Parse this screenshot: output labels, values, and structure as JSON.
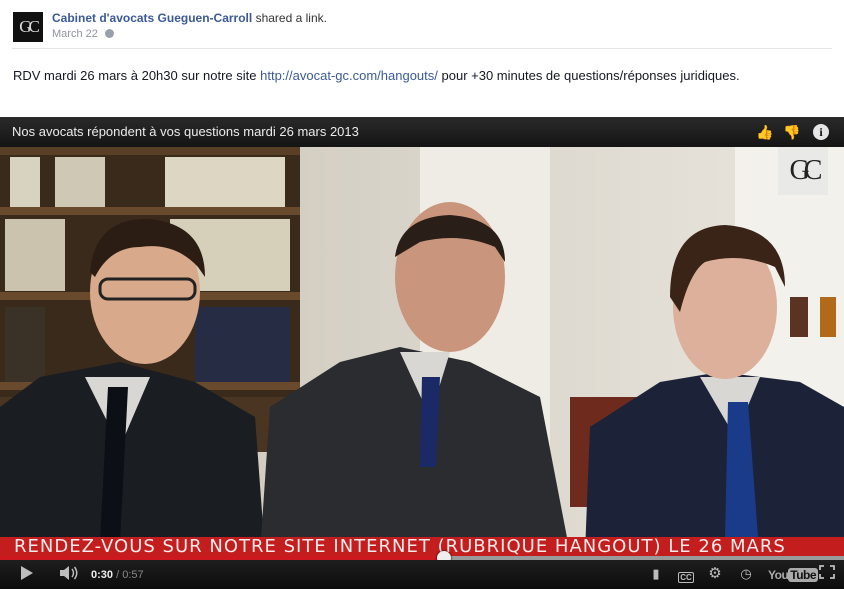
{
  "post": {
    "author": "Cabinet d'avocats Gueguen-Carroll",
    "action": "shared a link.",
    "date": "March 22",
    "avatar_letters": "GC",
    "message_pre": "RDV mardi 26 mars à 20h30 sur notre site ",
    "link": "http://avocat-gc.com/hangouts/",
    "message_post": " pour +30 minutes de questions/réponses juridiques."
  },
  "video": {
    "title": "Nos avocats répondent à vos questions mardi 26 mars 2013",
    "watermark": "GC",
    "banner": "RENDEZ-VOUS SUR NOTRE SITE INTERNET (RUBRIQUE HANGOUT) LE 26 MARS",
    "current_time": "0:30",
    "duration": "/ 0:57",
    "progress_fraction": 0.526,
    "buffered_fraction": 1.0,
    "logo_you": "You",
    "logo_tube": "Tube"
  },
  "icons": {
    "like": "thumbs-up-icon",
    "dislike": "thumbs-down-icon",
    "info": "info-icon",
    "play": "play-icon",
    "volume": "volume-icon",
    "comment": "annotation-icon",
    "captions": "captions-icon",
    "settings": "gear-icon",
    "watch_later": "clock-icon",
    "fullscreen": "fullscreen-icon"
  },
  "colors": {
    "link": "#3b5998",
    "banner": "#c41d1d",
    "progress": "#cc181e"
  }
}
